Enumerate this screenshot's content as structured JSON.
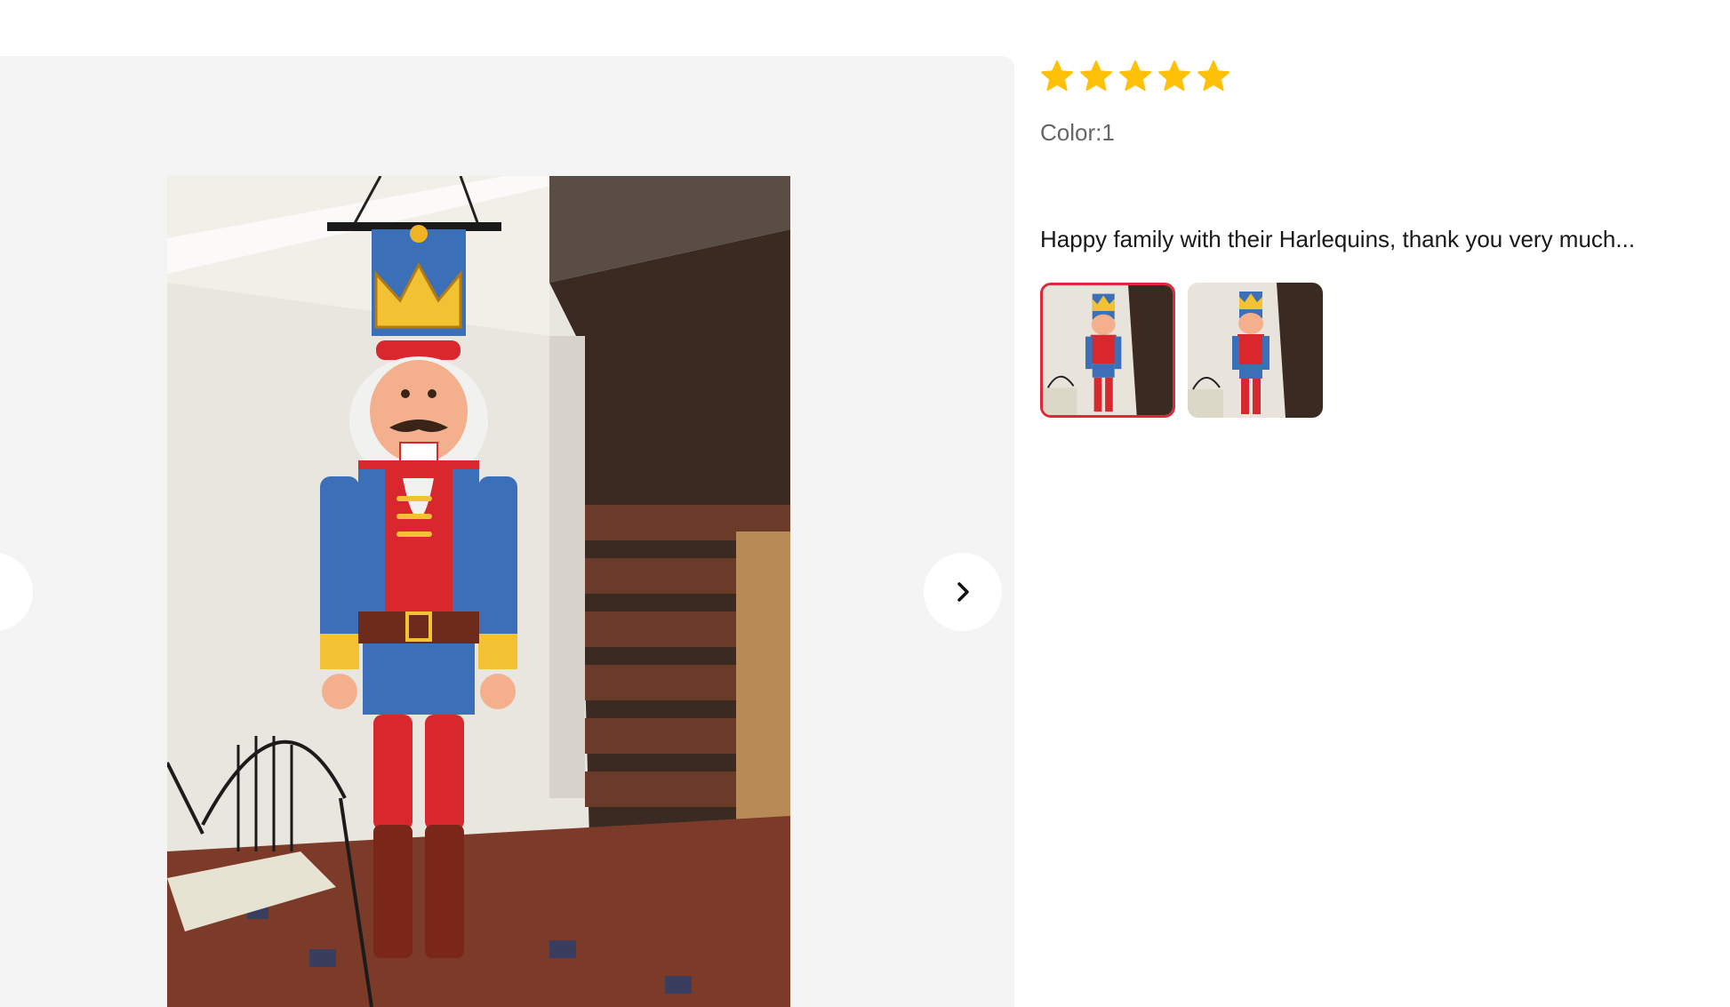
{
  "review": {
    "rating": 5,
    "rating_max": 5,
    "color_label": "Color:1",
    "text": "Happy family with their Harlequins, thank you very much..."
  },
  "gallery": {
    "main_photo_alt": "nutcracker-photo",
    "thumbnails": [
      {
        "name": "photo-1",
        "selected": true
      },
      {
        "name": "photo-2",
        "selected": false
      }
    ]
  },
  "colors": {
    "star": "#FFC107",
    "panel_bg": "#f4f4f4",
    "selected_border": "#e0283c",
    "text_primary": "#191919",
    "text_secondary": "#666666"
  },
  "icons": {
    "prev": "chevron-left-icon",
    "next": "chevron-right-icon",
    "star": "star-icon"
  }
}
